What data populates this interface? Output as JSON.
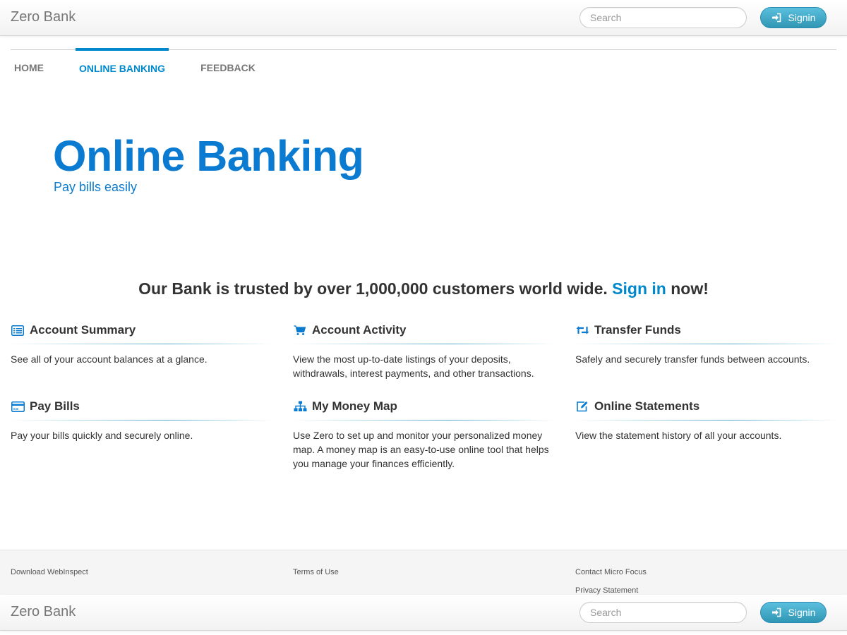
{
  "header": {
    "brand": "Zero Bank",
    "search_placeholder": "Search",
    "signin_label": "Signin"
  },
  "tabs": [
    {
      "label": "HOME",
      "active": false
    },
    {
      "label": "ONLINE BANKING",
      "active": true
    },
    {
      "label": "FEEDBACK",
      "active": false
    }
  ],
  "hero": {
    "title": "Online Banking",
    "subtitle": "Pay bills easily"
  },
  "trust": {
    "text": "Our Bank is trusted by over 1,000,000 customers world wide.",
    "link": "Sign in",
    "suffix": "now!"
  },
  "features": [
    {
      "title": "Account Summary",
      "icon": "list-alt-icon",
      "text": "See all of your account balances at a glance."
    },
    {
      "title": "Account Activity",
      "icon": "shopping-cart-icon",
      "text": "View the most up-to-date listings of your deposits, withdrawals, interest payments, and other transactions."
    },
    {
      "title": "Transfer Funds",
      "icon": "retweet-icon",
      "text": "Safely and securely transfer funds between accounts."
    },
    {
      "title": "Pay Bills",
      "icon": "credit-card-icon",
      "text": "Pay your bills quickly and securely online."
    },
    {
      "title": "My Money Map",
      "icon": "sitemap-icon",
      "text": "Use Zero to set up and monitor your personalized money map. A money map is an easy-to-use online tool that helps you manage your finances efficiently."
    },
    {
      "title": "Online Statements",
      "icon": "edit-icon",
      "text": "View the statement history of all your accounts."
    }
  ],
  "footer": {
    "download": "Download WebInspect",
    "terms": "Terms of Use",
    "contact": "Contact Micro Focus",
    "privacy": "Privacy Statement"
  },
  "colors": {
    "accent": "#0088cc",
    "hero": "#0a7bd1",
    "button": "#2f96b4"
  }
}
